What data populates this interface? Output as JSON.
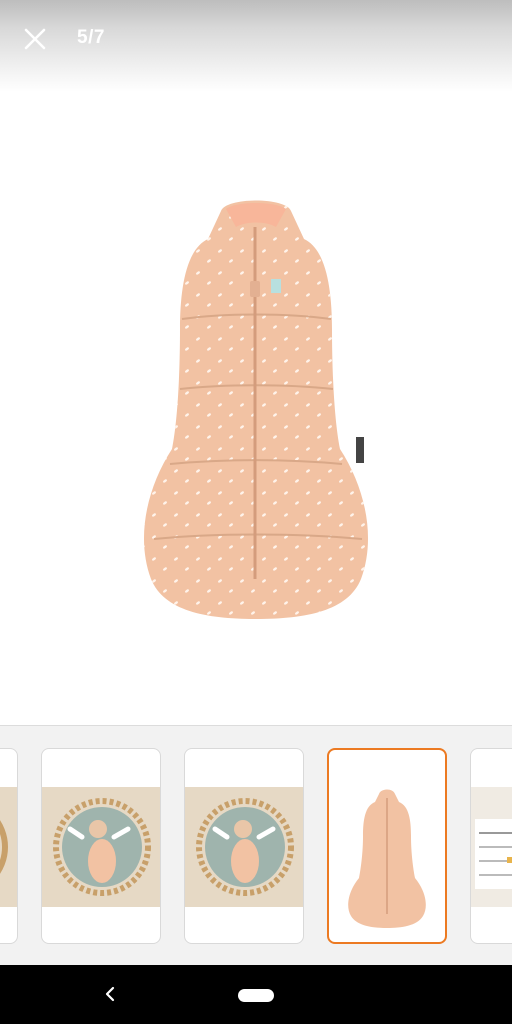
{
  "header": {
    "counter": "5/7",
    "close_icon": "close-icon"
  },
  "main_image": {
    "subject": "sleep-sack-image"
  },
  "thumbnails": [
    {
      "name": "thumbnail-2",
      "kind": "baby-photo"
    },
    {
      "name": "thumbnail-3",
      "kind": "baby-photo"
    },
    {
      "name": "thumbnail-4",
      "kind": "baby-photo"
    },
    {
      "name": "thumbnail-5",
      "kind": "product",
      "selected": true
    },
    {
      "name": "thumbnail-6",
      "kind": "size-chart"
    }
  ],
  "colors": {
    "accent": "#ec7a22",
    "product": "#f2c2a3",
    "background": "#ffffff"
  },
  "navbar": {
    "back_icon": "back-chevron-icon",
    "home_icon": "home-pill"
  }
}
